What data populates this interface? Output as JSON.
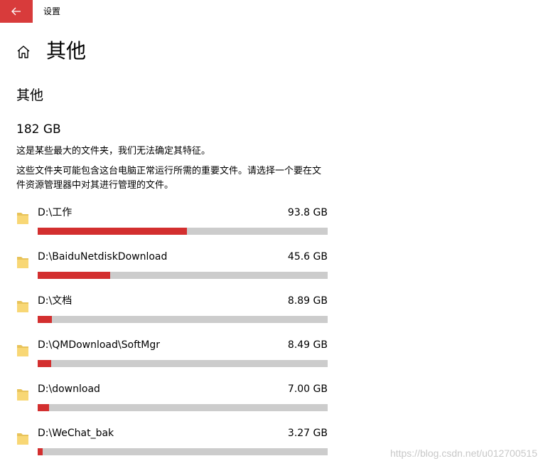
{
  "window": {
    "title": "设置"
  },
  "header": {
    "page_title": "其他"
  },
  "main": {
    "section_title": "其他",
    "total_size": "182 GB",
    "description_1": "这是某些最大的文件夹，我们无法确定其特征。",
    "description_2": "这些文件夹可能包含这台电脑正常运行所需的重要文件。请选择一个要在文件资源管理器中对其进行管理的文件。",
    "folders": [
      {
        "path": "D:\\工作",
        "size": "93.8 GB",
        "usage_fraction": 0.515
      },
      {
        "path": "D:\\BaiduNetdiskDownload",
        "size": "45.6 GB",
        "usage_fraction": 0.25
      },
      {
        "path": "D:\\文档",
        "size": "8.89 GB",
        "usage_fraction": 0.049
      },
      {
        "path": "D:\\QMDownload\\SoftMgr",
        "size": "8.49 GB",
        "usage_fraction": 0.047
      },
      {
        "path": "D:\\download",
        "size": "7.00 GB",
        "usage_fraction": 0.039
      },
      {
        "path": "D:\\WeChat_bak",
        "size": "3.27 GB",
        "usage_fraction": 0.018
      }
    ]
  },
  "watermark": "https://blog.csdn.net/u012700515",
  "icons": {
    "back": "back-arrow-icon",
    "home": "home-icon",
    "folder": "folder-icon"
  },
  "colors": {
    "accent": "#d83b3b",
    "usage_fill": "#d32f2f",
    "usage_track": "#cccccc",
    "folder_yellow": "#f8d775"
  }
}
